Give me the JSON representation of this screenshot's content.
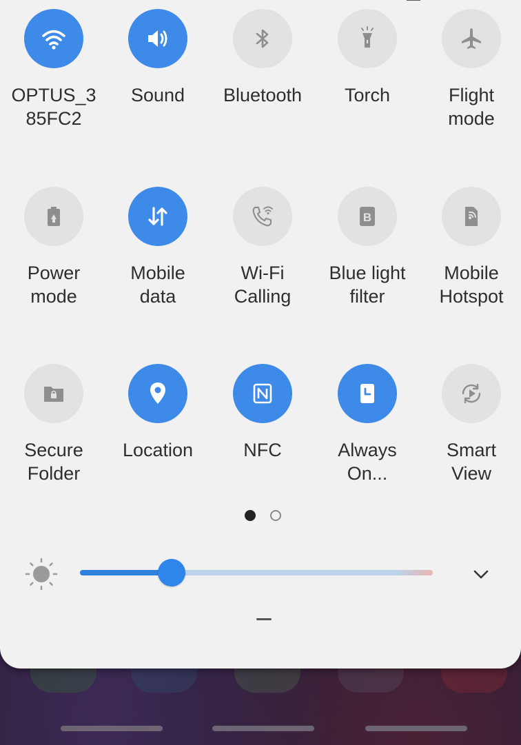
{
  "quick_panel": {
    "tiles": [
      {
        "id": "wifi",
        "label_line1": "OPTUS_3",
        "label_line2": "85FC2",
        "active": true,
        "icon": "wifi-icon"
      },
      {
        "id": "sound",
        "label_line1": "Sound",
        "label_line2": "",
        "active": true,
        "icon": "speaker-icon"
      },
      {
        "id": "bluetooth",
        "label_line1": "Bluetooth",
        "label_line2": "",
        "active": false,
        "icon": "bluetooth-icon"
      },
      {
        "id": "torch",
        "label_line1": "Torch",
        "label_line2": "",
        "active": false,
        "icon": "torch-icon"
      },
      {
        "id": "flight",
        "label_line1": "Flight",
        "label_line2": "mode",
        "active": false,
        "icon": "airplane-icon"
      },
      {
        "id": "power",
        "label_line1": "Power",
        "label_line2": "mode",
        "active": false,
        "icon": "battery-icon"
      },
      {
        "id": "mobile-data",
        "label_line1": "Mobile",
        "label_line2": "data",
        "active": true,
        "icon": "data-arrows-icon"
      },
      {
        "id": "wifi-calling",
        "label_line1": "Wi-Fi",
        "label_line2": "Calling",
        "active": false,
        "icon": "wifi-calling-icon"
      },
      {
        "id": "blue-light",
        "label_line1": "Blue light",
        "label_line2": "filter",
        "active": false,
        "icon": "blue-light-icon"
      },
      {
        "id": "hotspot",
        "label_line1": "Mobile",
        "label_line2": "Hotspot",
        "active": false,
        "icon": "hotspot-icon"
      },
      {
        "id": "secure-folder",
        "label_line1": "Secure",
        "label_line2": "Folder",
        "active": false,
        "icon": "folder-lock-icon"
      },
      {
        "id": "location",
        "label_line1": "Location",
        "label_line2": "",
        "active": true,
        "icon": "location-pin-icon"
      },
      {
        "id": "nfc",
        "label_line1": "NFC",
        "label_line2": "",
        "active": true,
        "icon": "nfc-icon"
      },
      {
        "id": "always-on",
        "label_line1": "Always",
        "label_line2": "On...",
        "active": true,
        "icon": "clock-display-icon"
      },
      {
        "id": "smart-view",
        "label_line1": "Smart",
        "label_line2": "View",
        "active": false,
        "icon": "smart-view-icon"
      }
    ],
    "pages": {
      "current": 1,
      "total": 2
    },
    "brightness": {
      "level": 0.26
    },
    "colors": {
      "active": "#3d8ae8",
      "inactive": "#e2e2e2",
      "panel": "#f1f1f1"
    }
  }
}
